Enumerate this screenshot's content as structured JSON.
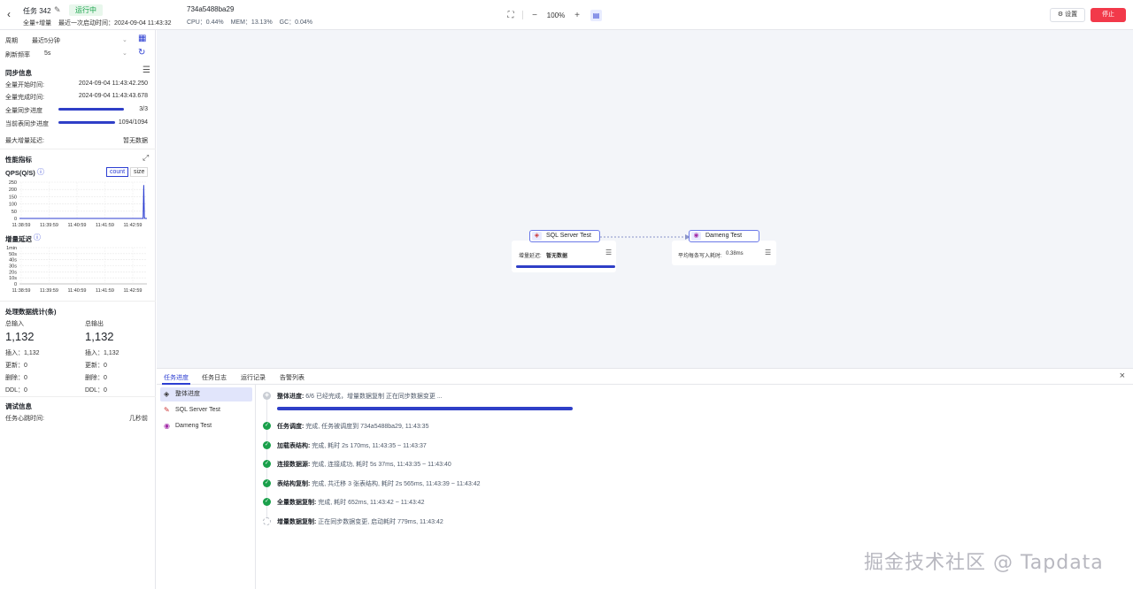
{
  "header": {
    "back_icon": "chevron-left-icon",
    "task_name": "任务 342",
    "status": "运行中",
    "sync_type": "全量+增量",
    "last_start": "最近一次启动时间：2024-09-04 11:43:32",
    "task_id": "734a5488ba29",
    "cpu": "CPU：0.44%",
    "mem": "MEM：13.13%",
    "gc": "GC：0.04%",
    "zoom": "100%",
    "settings_label": "⚙ 设置",
    "stop_label": "停止",
    "colors": {
      "accent": "#2c3ed2",
      "stop": "#f2394a",
      "running_bg": "#e8f7ec",
      "running_fg": "#17a34a"
    }
  },
  "left": {
    "period_label": "周期",
    "period_value": "最近5分钟",
    "refresh_label": "刷新频率",
    "refresh_value": "5s",
    "sync_title": "同步信息",
    "full_start_label": "全量开始时间:",
    "full_start_value": "2024-09-04 11:43:42.250",
    "full_done_label": "全量完成时间:",
    "full_done_value": "2024-09-04 11:43:43.678",
    "full_progress_label": "全量同步进度",
    "full_progress_value": "3/3",
    "full_progress_fraction": 1.0,
    "table_progress_label": "当前表同步进度",
    "table_progress_value": "1094/1094",
    "table_progress_fraction": 1.0,
    "max_delay_label": "最大增量延迟:",
    "max_delay_value": "暂无数据",
    "perf_title": "性能指标",
    "qps_title": "QPS(Q/S)",
    "seg_count": "count",
    "seg_size": "size",
    "delay_title": "增量延迟",
    "stats_title": "处理数据统计(条)",
    "input_label": "总输入",
    "input_value": "1,132",
    "output_label": "总输出",
    "output_value": "1,132",
    "in_insert": "插入：1,132",
    "in_update": "更新：0",
    "in_delete": "删除：0",
    "in_ddl": "DDL：0",
    "out_insert": "插入：1,132",
    "out_update": "更新：0",
    "out_delete": "删除：0",
    "out_ddl": "DDL：0",
    "debug_title": "调试信息",
    "heartbeat_label": "任务心跳时间:",
    "heartbeat_value": "几秒前"
  },
  "chart_data": [
    {
      "type": "line",
      "title": "QPS(Q/S)",
      "categories": [
        "11:38:59",
        "11:39:59",
        "11:40:59",
        "11:41:59",
        "11:42:59"
      ],
      "y_ticks": [
        "250",
        "200",
        "150",
        "100",
        "50",
        "0"
      ],
      "ylim": [
        0,
        250
      ],
      "series": [
        {
          "values_x": [
            0,
            0.85,
            0.97,
            0.975,
            0.98,
            0.985,
            1.0
          ],
          "values_y": [
            0,
            0,
            0,
            230,
            10,
            0,
            0
          ]
        }
      ]
    },
    {
      "type": "line",
      "title": "增量延迟",
      "categories": [
        "11:38:59",
        "11:39:59",
        "11:40:59",
        "11:41:59",
        "11:42:59"
      ],
      "y_ticks": [
        "1min",
        "50s",
        "40s",
        "30s",
        "20s",
        "10s",
        "0"
      ],
      "series": []
    }
  ],
  "canvas": {
    "source_node": "SQL Server Test",
    "source_delay_label": "增量延迟:",
    "source_delay_value": "暂无数据",
    "target_node": "Dameng Test",
    "target_label": "平均每条写入耗时:",
    "target_value": "0.38ms"
  },
  "bottom": {
    "tabs": [
      "任务进度",
      "任务日志",
      "运行记录",
      "告警列表"
    ],
    "side_items": [
      "整体进度",
      "SQL Server Test",
      "Dameng Test"
    ],
    "overall_label": "整体进度:",
    "overall_text": "6/6 已经完成，增量数据复制 正在同步数据变更 ...",
    "steps": [
      {
        "label": "任务调度:",
        "text": "完成, 任务被调度到 734a5488ba29, 11:43:35",
        "state": "done"
      },
      {
        "label": "加载表结构:",
        "text": "完成, 耗时 2s 170ms, 11:43:35 ~ 11:43:37",
        "state": "done"
      },
      {
        "label": "连接数据源:",
        "text": "完成, 连接成功, 耗时 5s 37ms, 11:43:35 ~ 11:43:40",
        "state": "done"
      },
      {
        "label": "表结构复制:",
        "text": "完成, 共迁移 3 张表结构, 耗时 2s 565ms, 11:43:39 ~ 11:43:42",
        "state": "done"
      },
      {
        "label": "全量数据复制:",
        "text": "完成, 耗时 652ms, 11:43:42 ~ 11:43:42",
        "state": "done"
      },
      {
        "label": "增量数据复制:",
        "text": "正在同步数据变更, 启动耗时 779ms, 11:43:42",
        "state": "pending"
      }
    ]
  },
  "watermark": "掘金技术社区 @ Tapdata"
}
